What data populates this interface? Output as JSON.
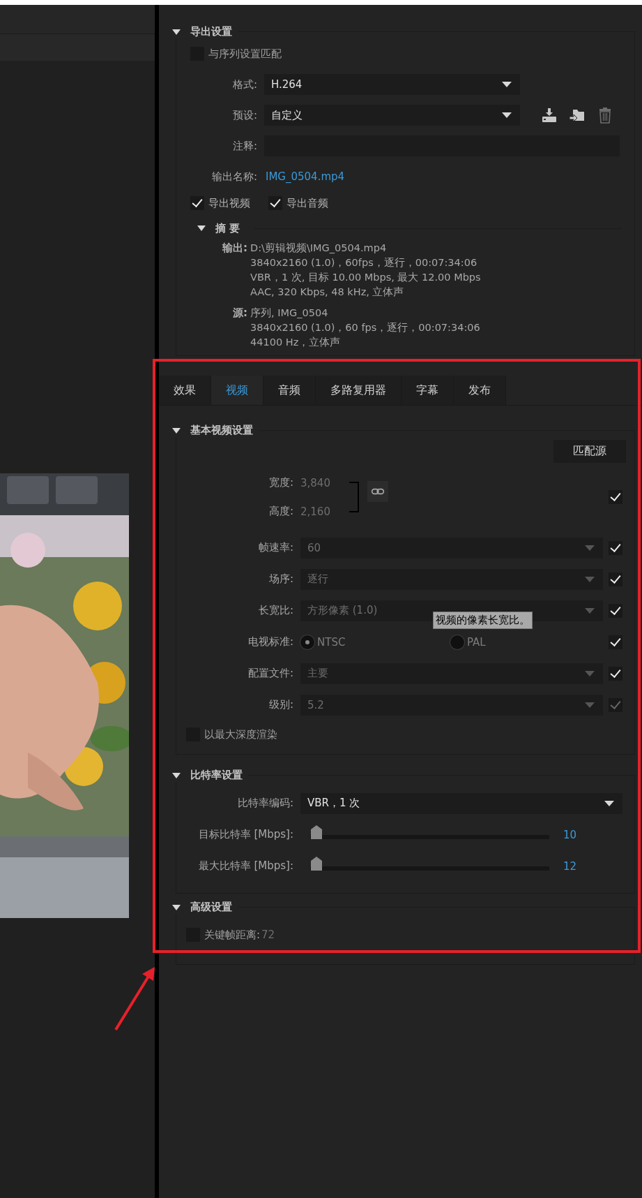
{
  "export_settings": {
    "title": "导出设置",
    "expanded": true,
    "match_sequence": {
      "label": "与序列设置匹配",
      "checked": false
    },
    "format": {
      "label": "格式:",
      "value": "H.264"
    },
    "preset": {
      "label": "预设:",
      "value": "自定义"
    },
    "comments": {
      "label": "注释:"
    },
    "output_name": {
      "label": "输出名称:",
      "value": "IMG_0504.mp4"
    },
    "export_video": {
      "label": "导出视频",
      "checked": true
    },
    "export_audio": {
      "label": "导出音频",
      "checked": true
    },
    "summary": {
      "title": "摘 要",
      "expanded": true,
      "output": {
        "label": "输出:",
        "lines": [
          "D:\\剪辑视频\\IMG_0504.mp4",
          "3840x2160 (1.0)，60fps，逐行，00:07:34:06",
          "VBR，1 次, 目标 10.00 Mbps, 最大 12.00 Mbps",
          "AAC, 320 Kbps, 48  kHz, 立体声"
        ]
      },
      "source": {
        "label": "源:",
        "lines": [
          "序列, IMG_0504",
          "3840x2160 (1.0)，60 fps，逐行，00:07:34:06",
          "44100 Hz，立体声"
        ]
      }
    }
  },
  "tabs": [
    {
      "label": "效果",
      "selected": false
    },
    {
      "label": "视频",
      "selected": true
    },
    {
      "label": "音频",
      "selected": false
    },
    {
      "label": "多路复用器",
      "selected": false
    },
    {
      "label": "字幕",
      "selected": false
    },
    {
      "label": "发布",
      "selected": false
    }
  ],
  "basic_video": {
    "title": "基本视频设置",
    "expanded": true,
    "match_source_button": "匹配源",
    "width": {
      "label": "宽度:",
      "value": "3,840"
    },
    "height": {
      "label": "高度:",
      "value": "2,160"
    },
    "dimensions_checked": true,
    "rows": [
      {
        "kind": "dropdown",
        "label": "帧速率:",
        "value": "60",
        "checked": true,
        "checkbox_disabled": false
      },
      {
        "kind": "dropdown",
        "label": "场序:",
        "value": "逐行",
        "checked": true,
        "checkbox_disabled": false
      },
      {
        "kind": "dropdown",
        "label": "长宽比:",
        "value": "方形像素 (1.0)",
        "checked": true,
        "checkbox_disabled": false
      },
      {
        "kind": "radio",
        "label": "电视标准:",
        "options": [
          {
            "label": "NTSC",
            "selected": true
          },
          {
            "label": "PAL",
            "selected": false
          }
        ],
        "checked": true,
        "checkbox_disabled": false
      },
      {
        "kind": "dropdown",
        "label": "配置文件:",
        "value": "主要",
        "checked": true,
        "checkbox_disabled": false
      },
      {
        "kind": "dropdown",
        "label": "级别:",
        "value": "5.2",
        "checked": true,
        "checkbox_disabled": true
      }
    ],
    "render_max_depth": {
      "label": "以最大深度渲染",
      "checked": false
    },
    "tooltip": "视频的像素长宽比。"
  },
  "bitrate": {
    "title": "比特率设置",
    "expanded": true,
    "encoding": {
      "label": "比特率编码:",
      "value": "VBR，1 次"
    },
    "sliders": [
      {
        "label": "目标比特率 [Mbps]:",
        "level": 0.01,
        "reading": "10"
      },
      {
        "label": "最大比特率 [Mbps]:",
        "level": 0.01,
        "reading": "12"
      }
    ]
  },
  "advanced": {
    "title": "高级设置",
    "expanded": true,
    "keyframe": {
      "label": "关键帧距离:",
      "value": "72",
      "checked": false
    }
  }
}
